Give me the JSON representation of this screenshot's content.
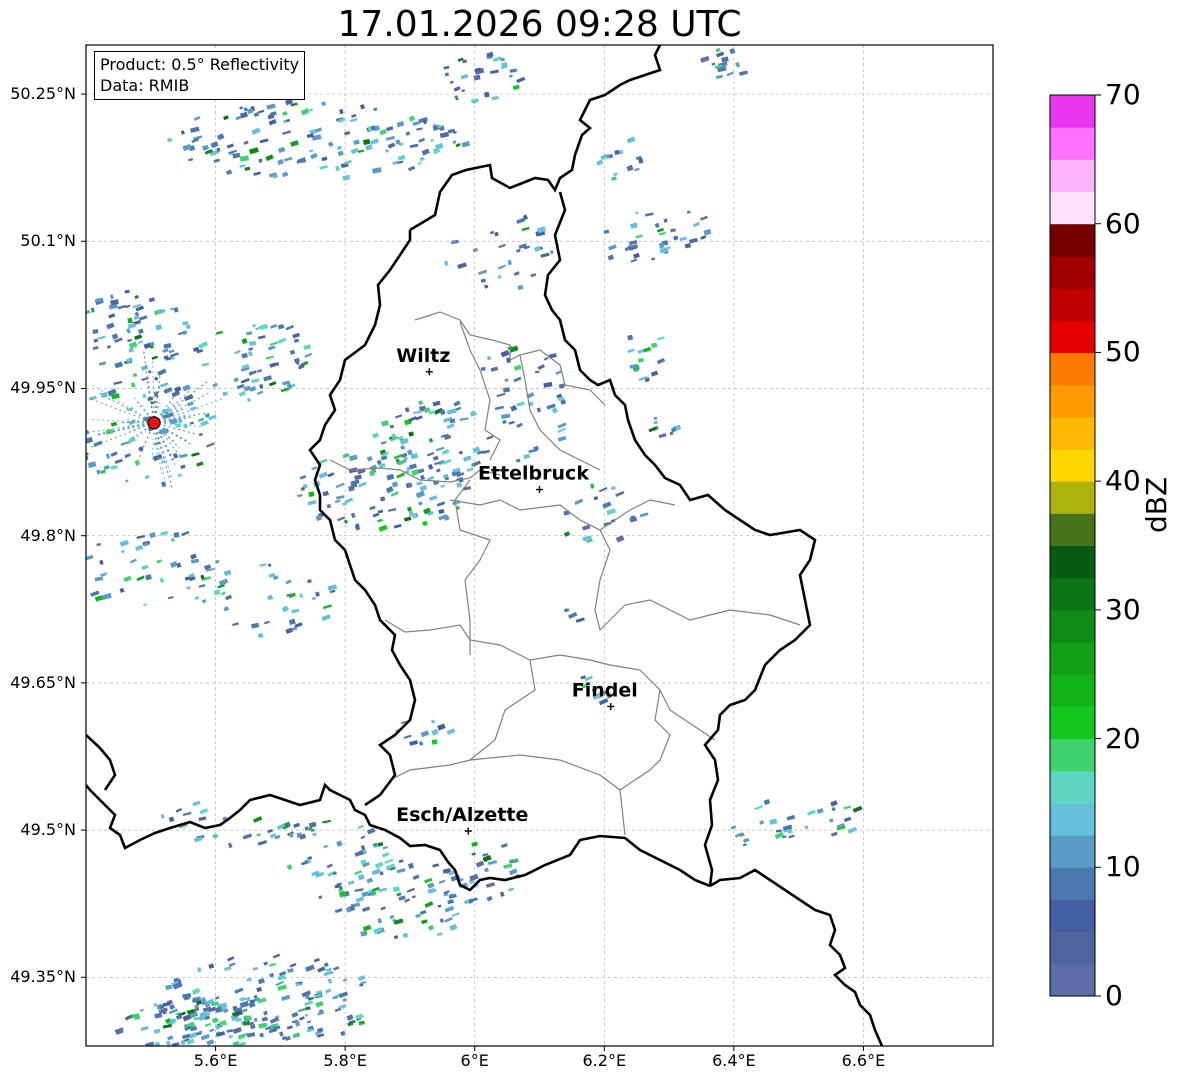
{
  "title": "17.01.2026 09:28 UTC",
  "info": {
    "product": "Product: 0.5° Reflectivity",
    "data": "Data: RMIB"
  },
  "axes": {
    "lat_labels": [
      "50.25°N",
      "50.1°N",
      "49.95°N",
      "49.8°N",
      "49.65°N",
      "49.5°N",
      "49.35°N"
    ],
    "lon_labels": [
      "5.6°E",
      "5.8°E",
      "6°E",
      "6.2°E",
      "6.4°E",
      "6.6°E"
    ],
    "lon_range": [
      5.4,
      6.8
    ],
    "lat_range": [
      49.28,
      50.3
    ]
  },
  "cities": [
    {
      "name": "Wiltz",
      "lon": 5.93,
      "lat": 49.967
    },
    {
      "name": "Ettelbruck",
      "lon": 6.1,
      "lat": 49.847
    },
    {
      "name": "Findel",
      "lon": 6.21,
      "lat": 49.626
    },
    {
      "name": "Esch/Alzette",
      "lon": 5.99,
      "lat": 49.499
    }
  ],
  "radar_site": {
    "lon": 5.505,
    "lat": 49.915
  },
  "colorbar": {
    "label": "dBZ",
    "min": 0,
    "max": 70,
    "ticks": [
      "70",
      "60",
      "50",
      "40",
      "30",
      "20",
      "10",
      "0"
    ],
    "colors": [
      "#5d6ea6",
      "#4f65a0",
      "#445fa3",
      "#4a79b0",
      "#5a9cc5",
      "#66c0dc",
      "#5dd6c4",
      "#3fd26d",
      "#12c81f",
      "#12b41a",
      "#12a018",
      "#108c16",
      "#0c7414",
      "#0b5a12",
      "#47741b",
      "#adb30a",
      "#fed600",
      "#feb800",
      "#ff9a00",
      "#ff7b00",
      "#e40000",
      "#c00000",
      "#9f0000",
      "#760000",
      "#ffe0ff",
      "#ffb4ff",
      "#ff72ff",
      "#eb36f0"
    ]
  },
  "colors": {
    "border_country": "#000000",
    "border_canton": "#808080",
    "gridline": "#b4b4b4",
    "radar_dot": "#e81010"
  }
}
